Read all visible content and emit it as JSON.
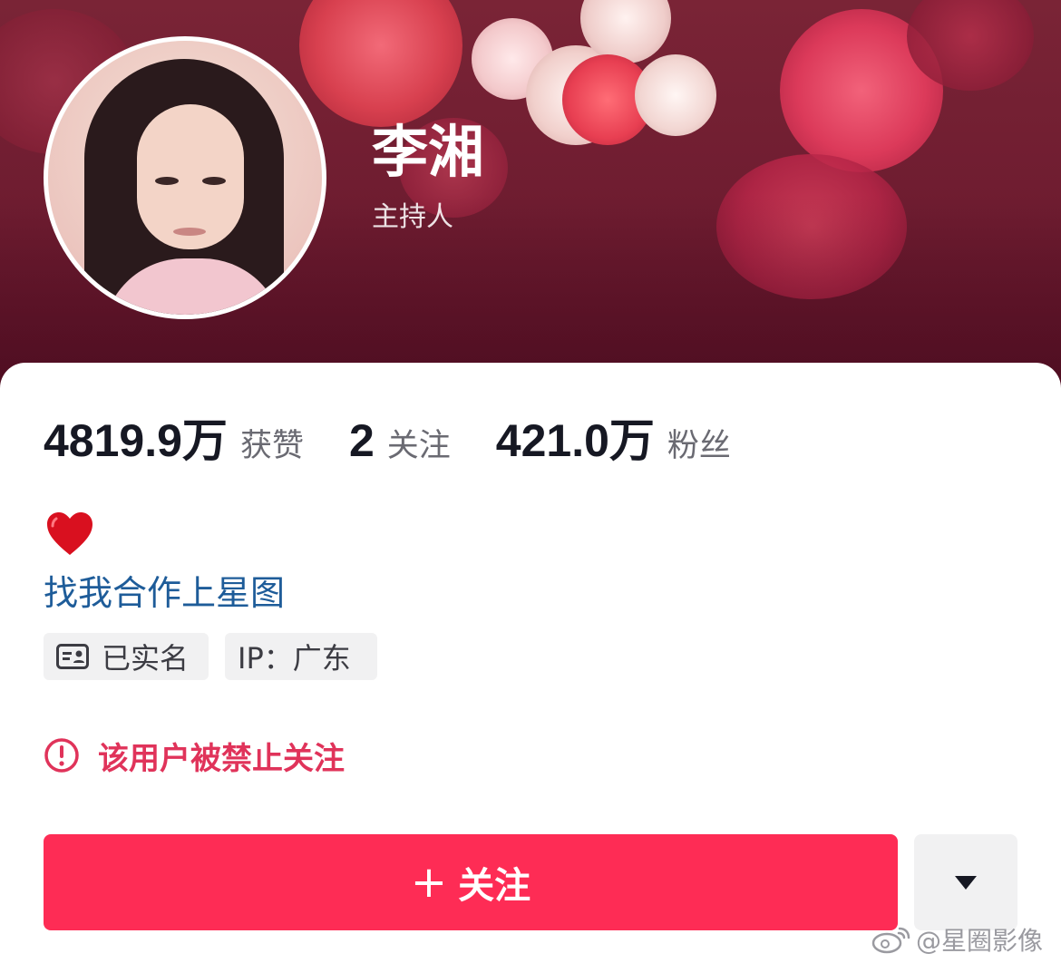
{
  "profile": {
    "name": "李湘",
    "subtitle": "主持人"
  },
  "stats": {
    "likes": {
      "value": "4819.9万",
      "label": "获赞"
    },
    "following": {
      "value": "2",
      "label": "关注"
    },
    "followers": {
      "value": "421.0万",
      "label": "粉丝"
    }
  },
  "bio": {
    "emoji": "heart-icon",
    "link_text": "找我合作上星图"
  },
  "tags": {
    "verified": "已实名",
    "ip": "IP：广东"
  },
  "warning": {
    "text": "该用户被禁止关注"
  },
  "actions": {
    "follow_plus": "+",
    "follow_label": "关注"
  },
  "watermark": {
    "text": "@星圈影像"
  },
  "colors": {
    "follow_button": "#fe2c55",
    "warning_text": "#e0335a",
    "bio_link": "#1e5c99",
    "header_bg": "#6e1c30"
  },
  "icons": [
    "id-card-icon",
    "alert-circle-icon",
    "caret-down-icon",
    "weibo-icon",
    "heart-icon"
  ]
}
